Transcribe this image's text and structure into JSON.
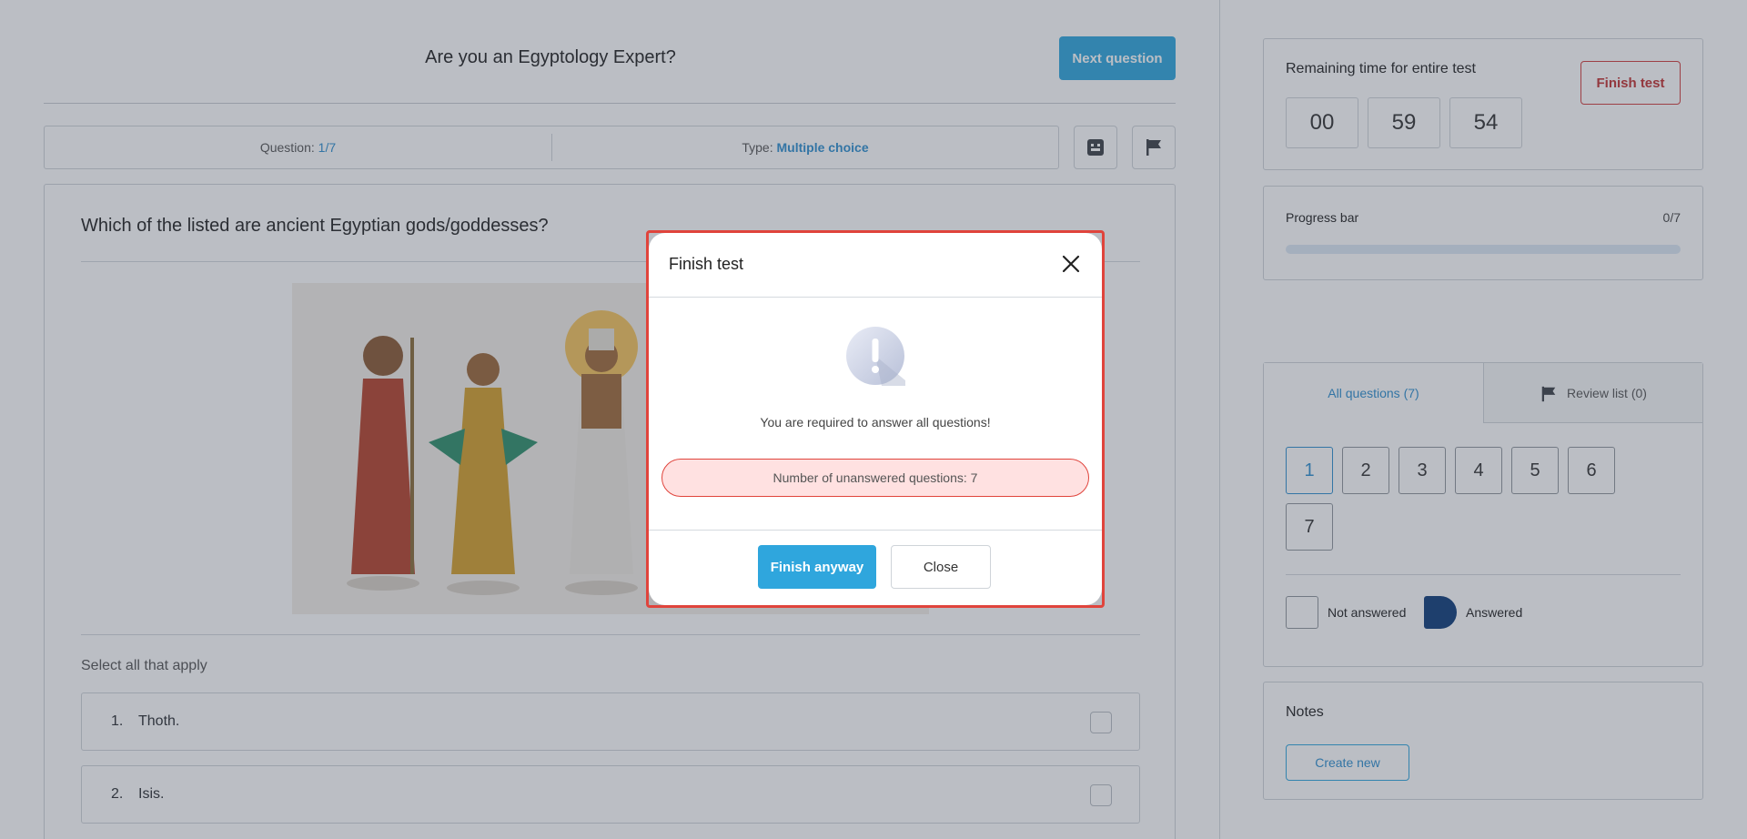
{
  "header": {
    "title": "Are you an Egyptology Expert?",
    "next_label": "Next question"
  },
  "meta": {
    "question_label": "Question:",
    "question_value": "1/7",
    "type_label": "Type:",
    "type_value": "Multiple choice"
  },
  "icons": {
    "calculator": "calculator-icon",
    "flag": "flag-icon",
    "close": "close-icon",
    "warning": "exclamation-icon"
  },
  "question": {
    "text": "Which of the listed are ancient Egyptian gods/goddesses?",
    "instruction": "Select all that apply",
    "answers": [
      {
        "num": "1.",
        "text": "Thoth."
      },
      {
        "num": "2.",
        "text": "Isis."
      }
    ]
  },
  "timer": {
    "label": "Remaining time for entire test",
    "hours": "00",
    "minutes": "59",
    "seconds": "54",
    "finish_label": "Finish test"
  },
  "progress": {
    "label": "Progress bar",
    "count": "0/7",
    "fraction": 0
  },
  "questions_panel": {
    "tab_all": "All questions (7)",
    "tab_review": "Review list (0)",
    "numbers": [
      "1",
      "2",
      "3",
      "4",
      "5",
      "6",
      "7"
    ],
    "legend_not_answered": "Not answered",
    "legend_answered": "Answered"
  },
  "notes": {
    "label": "Notes",
    "create_label": "Create new"
  },
  "modal": {
    "title": "Finish test",
    "message": "You are required to answer all questions!",
    "unanswered": "Number of unanswered questions: 7",
    "finish_anyway": "Finish anyway",
    "close": "Close"
  },
  "colors": {
    "accent": "#2fa6dd",
    "danger": "#e0443c",
    "answered": "#0e3d7a"
  }
}
